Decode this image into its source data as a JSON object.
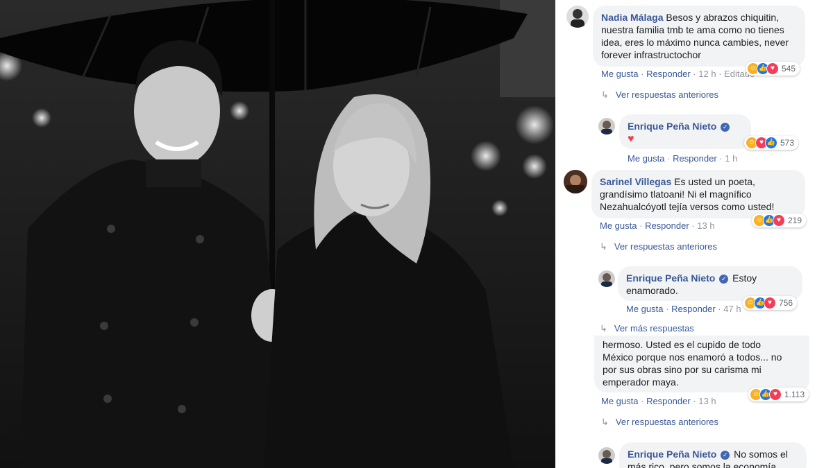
{
  "comments": [
    {
      "author": "Nadia Málaga",
      "text": "Besos y abrazos chiquitin, nuestra familia tmb te ama como no tienes idea, eres lo máximo nunca cambies, never forever infrastructochor",
      "like": "Me gusta",
      "reply": "Responder",
      "time": "12 h",
      "edited": "Editado",
      "reactions": "545"
    },
    {
      "author": "Enrique Peña Nieto",
      "text": "♥",
      "like": "Me gusta",
      "reply": "Responder",
      "time": "1 h",
      "reactions": "573"
    },
    {
      "author": "Sarinel Villegas",
      "text": "Es usted un poeta, grandísimo tlatoani! Ni el magnífico Nezahualcóyotl tejía versos como usted!",
      "like": "Me gusta",
      "reply": "Responder",
      "time": "13 h",
      "reactions": "219"
    },
    {
      "author": "Enrique Peña Nieto",
      "text": "Estoy enamorado.",
      "like": "Me gusta",
      "reply": "Responder",
      "time": "47 h",
      "reactions": "756"
    },
    {
      "text_lines": [
        "hermoso. Usted es el cupido de todo",
        "México porque nos enamoró a todos... no",
        "por sus obras sino por su carisma mi",
        "emperador maya."
      ],
      "like": "Me gusta",
      "reply": "Responder",
      "time": "13 h",
      "reactions": "1.113"
    },
    {
      "author": "Enrique Peña Nieto",
      "text_lines": [
        "No somos el",
        "más rico, pero somos la economía"
      ]
    }
  ],
  "replies_links": {
    "previous_1": "Ver respuestas anteriores",
    "previous_2": "Ver respuestas anteriores",
    "more": "Ver más respuestas",
    "previous_3": "Ver respuestas anteriores"
  },
  "icons": {
    "reply_arrow": "reply-arrow-icon",
    "verified": "verified-badge-icon",
    "haha": "haha-reaction-icon",
    "like": "like-reaction-icon",
    "love": "love-reaction-icon"
  },
  "colors": {
    "link": "#385898",
    "bubble": "#f2f3f5",
    "verified": "#4267b2",
    "meta": "#90949c"
  }
}
